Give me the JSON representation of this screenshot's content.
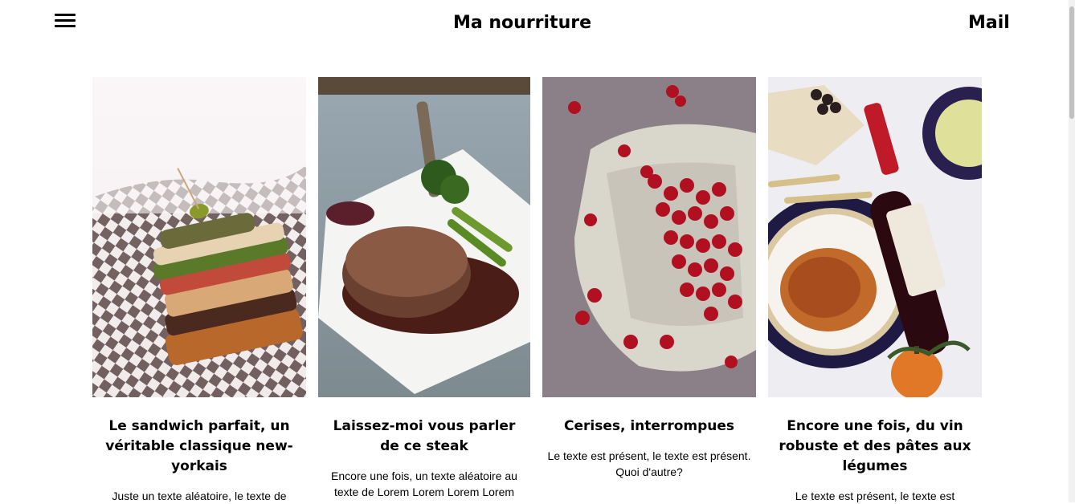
{
  "header": {
    "title": "Ma nourriture",
    "mail": "Mail"
  },
  "cards": [
    {
      "title": "Le sandwich parfait, un véritable classique new-yorkais",
      "text": "Juste un texte aléatoire, le texte de"
    },
    {
      "title": "Laissez-moi vous parler de ce steak",
      "text": "Encore une fois, un texte aléatoire au texte de Lorem Lorem Lorem Lorem"
    },
    {
      "title": "Cerises, interrompues",
      "text": "Le texte est présent, le texte est présent. Quoi d'autre?"
    },
    {
      "title": "Encore une fois, du vin robuste et des pâtes aux légumes",
      "text": "Le texte est présent, le texte est"
    }
  ]
}
